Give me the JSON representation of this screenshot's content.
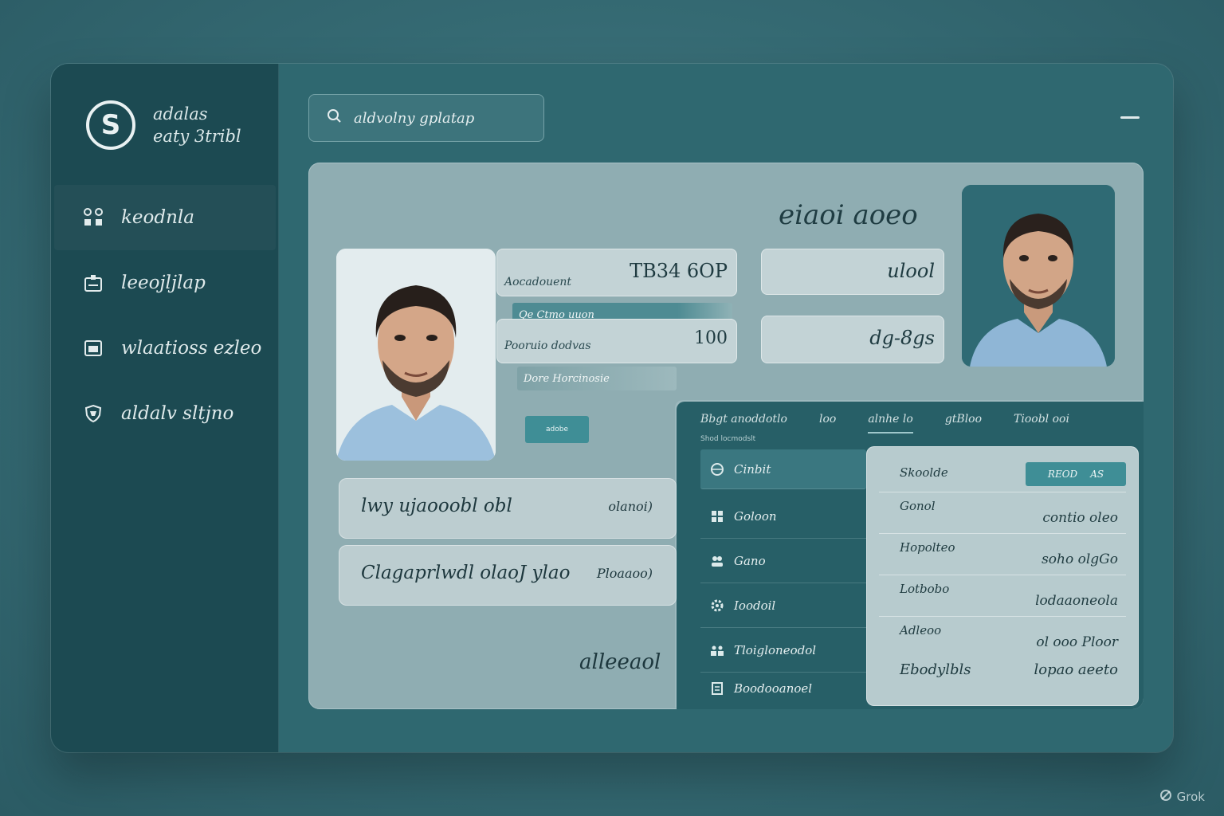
{
  "brand": {
    "logo_letter": "S",
    "line1": "adalas",
    "line2": "eaty 3tribl"
  },
  "sidebar": {
    "items": [
      {
        "label": "keodnla",
        "icon": "hierarchy-icon"
      },
      {
        "label": "leeojljlap",
        "icon": "id-card-icon"
      },
      {
        "label": "wlaatioss ezleo",
        "icon": "calendar-icon"
      },
      {
        "label": "aldalv sltjno",
        "icon": "shield-icon"
      }
    ]
  },
  "header": {
    "search_text": "aldvolny gplatap"
  },
  "profile": {
    "title": "eiaoi aoeo",
    "fields": {
      "id_label": "Aocadouent",
      "id_value": "TB34 6OP",
      "bar1_label": "Qe Ctmo uuon",
      "count_label": "Pooruio dodvas",
      "count_value": "100",
      "bar2_label": "Dore Horcinosie",
      "button_label": "adobe",
      "right1_value": "ulool",
      "right2_value": "dg-8gs"
    },
    "rows": [
      {
        "main": "lwy ujaooobl obl",
        "side": "olanoi)"
      },
      {
        "main": "Clagaprlwdl olaoJ ylao",
        "side": "Ploaaoo)"
      }
    ],
    "footer": "alleeaol"
  },
  "subwindow": {
    "tabs": [
      "Bbgt anoddotlo",
      "loo",
      "alnhe lo",
      "gtBloo",
      "Tioobl ooi"
    ],
    "tab_caption": "Shod locmodslt",
    "list": [
      {
        "label": "Cinbit",
        "icon": "globe-icon"
      },
      {
        "label": "Goloon",
        "icon": "grid-icon"
      },
      {
        "label": "Gano",
        "icon": "people-icon"
      },
      {
        "label": "Ioodoil",
        "icon": "settings-icon"
      },
      {
        "label": "Tloigloneodol",
        "icon": "team-icon"
      },
      {
        "label": "Boodooanoel",
        "icon": "document-icon"
      }
    ],
    "detail": {
      "header_key": "Skoolde",
      "badge_label": "REOD",
      "badge_extra": "AS",
      "rows": [
        {
          "k": "Gonol",
          "v": "contio oleo"
        },
        {
          "k": "Hopolteo",
          "v": "soho olgGo"
        },
        {
          "k": "Lotbobo",
          "v": "lodaaoneola"
        },
        {
          "k": "Adleoo",
          "v": "ol ooo Ploor"
        }
      ],
      "footer_key": "Ebodylbls",
      "footer_val": "lopao aeeto"
    }
  },
  "watermark": "Grok",
  "colors": {
    "sidebar": "#1c4a52",
    "panel": "#8fadb2",
    "accent": "#3f8e96",
    "background": "#356a73"
  }
}
